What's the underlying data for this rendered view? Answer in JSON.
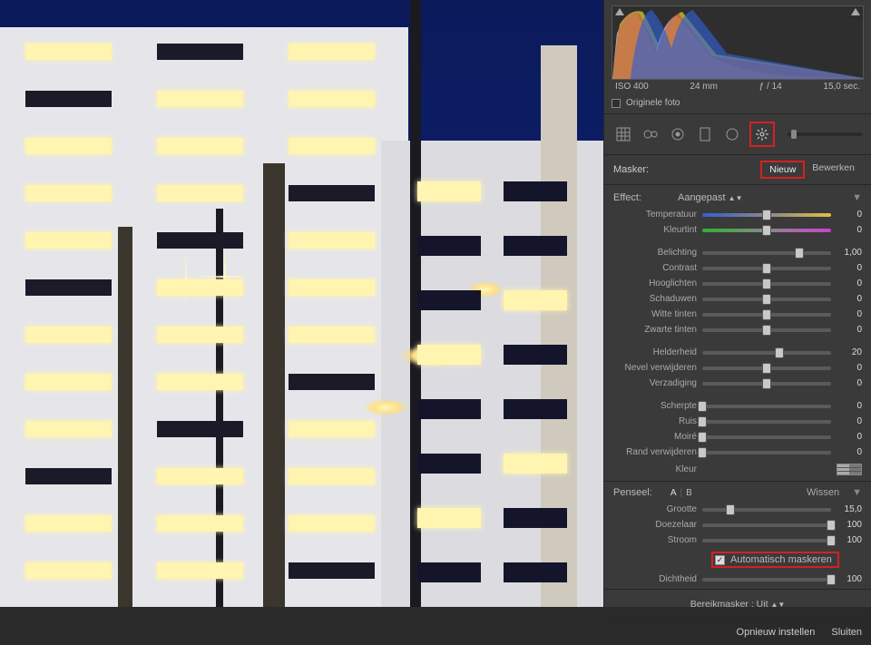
{
  "meta": {
    "iso": "ISO 400",
    "focal": "24 mm",
    "aperture": "ƒ / 14",
    "shutter": "15,0 sec."
  },
  "original_label": "Originele foto",
  "mask": {
    "label": "Masker:",
    "nieuw": "Nieuw",
    "bewerken": "Bewerken"
  },
  "effect": {
    "label": "Effect:",
    "preset": "Aangepast"
  },
  "sliders": {
    "temperatuur": {
      "label": "Temperatuur",
      "value": "0",
      "pos": 50
    },
    "kleurtint": {
      "label": "Kleurtint",
      "value": "0",
      "pos": 50
    },
    "belichting": {
      "label": "Belichting",
      "value": "1,00",
      "pos": 75
    },
    "contrast": {
      "label": "Contrast",
      "value": "0",
      "pos": 50
    },
    "hooglichten": {
      "label": "Hooglichten",
      "value": "0",
      "pos": 50
    },
    "schaduwen": {
      "label": "Schaduwen",
      "value": "0",
      "pos": 50
    },
    "witte": {
      "label": "Witte tinten",
      "value": "0",
      "pos": 50
    },
    "zwarte": {
      "label": "Zwarte tinten",
      "value": "0",
      "pos": 50
    },
    "helderheid": {
      "label": "Helderheid",
      "value": "20",
      "pos": 60
    },
    "nevel": {
      "label": "Nevel verwijderen",
      "value": "0",
      "pos": 50
    },
    "verzadiging": {
      "label": "Verzadiging",
      "value": "0",
      "pos": 50
    },
    "scherpte": {
      "label": "Scherpte",
      "value": "0",
      "pos": 0
    },
    "ruis": {
      "label": "Ruis",
      "value": "0",
      "pos": 0
    },
    "moire": {
      "label": "Moiré",
      "value": "0",
      "pos": 0
    },
    "rand": {
      "label": "Rand verwijderen",
      "value": "0",
      "pos": 0
    }
  },
  "kleur_label": "Kleur",
  "brush": {
    "label": "Penseel:",
    "a": "A",
    "b": "B",
    "wissen": "Wissen",
    "grootte": {
      "label": "Grootte",
      "value": "15,0",
      "pos": 22
    },
    "doezelaar": {
      "label": "Doezelaar",
      "value": "100",
      "pos": 100
    },
    "stroom": {
      "label": "Stroom",
      "value": "100",
      "pos": 100
    },
    "automask": "Automatisch maskeren",
    "dichtheid": {
      "label": "Dichtheid",
      "value": "100",
      "pos": 100
    }
  },
  "bereik": {
    "label": "Bereikmasker :",
    "value": "Uit"
  },
  "footer": {
    "reset": "Opnieuw instellen",
    "close": "Sluiten"
  }
}
